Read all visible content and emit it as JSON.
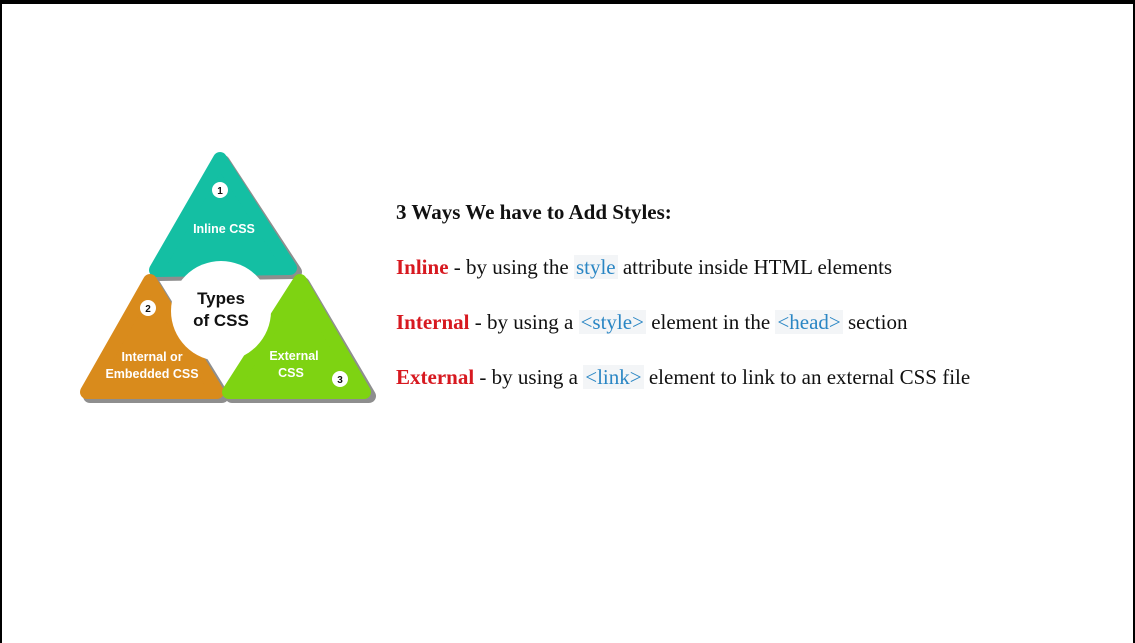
{
  "diagram": {
    "center_line1": "Types",
    "center_line2": "of CSS",
    "items": [
      {
        "number": "1",
        "label_line1": "Inline CSS",
        "label_line2": "",
        "color": "#14bfa3"
      },
      {
        "number": "2",
        "label_line1": "Internal or",
        "label_line2": "Embedded CSS",
        "color": "#d98b1c"
      },
      {
        "number": "3",
        "label_line1": "External",
        "label_line2": "CSS",
        "color": "#7ed312"
      }
    ]
  },
  "content": {
    "heading": "3 Ways We have to Add Styles:",
    "lines": [
      {
        "keyword": "Inline",
        "pre": " - by using the ",
        "code": "style",
        "post": " attribute inside HTML elements",
        "code2": "",
        "post2": ""
      },
      {
        "keyword": "Internal",
        "pre": " - by using a ",
        "code": "<style>",
        "post": " element in the ",
        "code2": "<head>",
        "post2": " section"
      },
      {
        "keyword": "External",
        "pre": " - by using a ",
        "code": "<link>",
        "post": " element to link to an external CSS file",
        "code2": "",
        "post2": ""
      }
    ]
  }
}
